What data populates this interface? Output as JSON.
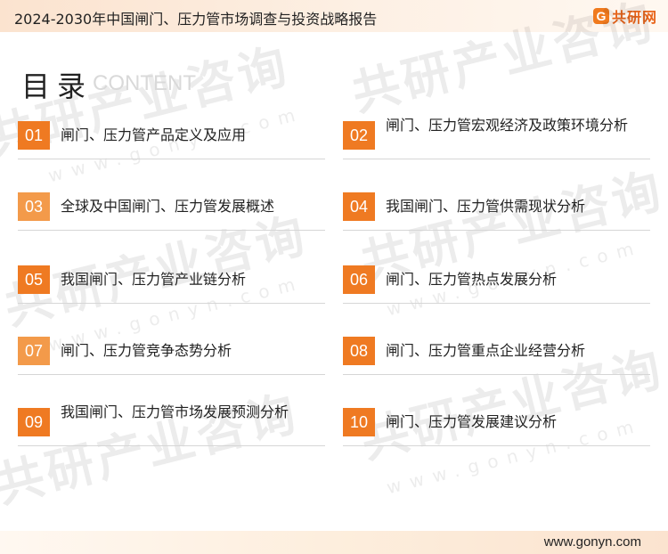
{
  "header": {
    "title": "2024-2030年中国闸门、压力管市场调查与投资战略报告",
    "brand_mark": "G",
    "brand_name": "共研网"
  },
  "watermark": {
    "text": "共研产业咨询",
    "url": "www.gonyn.com"
  },
  "toc": {
    "title": "目录",
    "subtitle": "CONTENT",
    "items": [
      {
        "num": "01",
        "label": "闸门、压力管产品定义及应用"
      },
      {
        "num": "02",
        "label": "闸门、压力管宏观经济及政策环境分析"
      },
      {
        "num": "03",
        "label": "全球及中国闸门、压力管发展概述"
      },
      {
        "num": "04",
        "label": "我国闸门、压力管供需现状分析"
      },
      {
        "num": "05",
        "label": "我国闸门、压力管产业链分析"
      },
      {
        "num": "06",
        "label": "闸门、压力管热点发展分析"
      },
      {
        "num": "07",
        "label": "闸门、压力管竞争态势分析"
      },
      {
        "num": "08",
        "label": "闸门、压力管重点企业经营分析"
      },
      {
        "num": "09",
        "label": "我国闸门、压力管市场发展预测分析"
      },
      {
        "num": "10",
        "label": "闸门、压力管发展建议分析"
      }
    ]
  },
  "footer": {
    "url": "www.gonyn.com"
  },
  "colors": {
    "accent": "#ef7a22",
    "accent_light": "#f39a4a"
  }
}
